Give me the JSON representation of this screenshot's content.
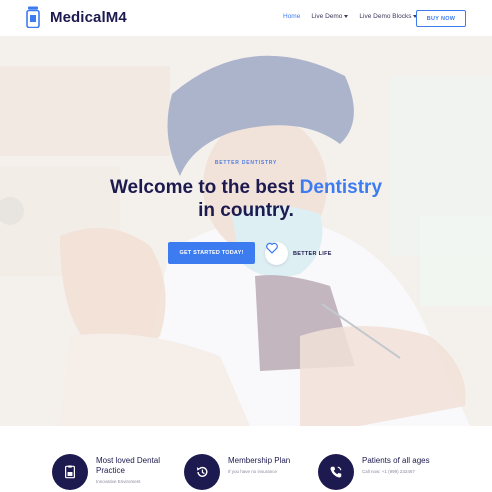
{
  "brand": {
    "name": "MedicalM4",
    "logo_icon": "medicine-bottle-icon",
    "accent": "#3d7bf0",
    "navy": "#1d1a4f"
  },
  "nav": {
    "items": [
      {
        "label": "Home",
        "active": true
      },
      {
        "label": "Live Demo",
        "dropdown": true
      },
      {
        "label": "Live Demo Blocks",
        "dropdown": true
      }
    ],
    "buy_label": "BUY NOW"
  },
  "hero": {
    "eyebrow": "BETTER DENTISTRY",
    "headline_part1": "Welcome to the best ",
    "headline_accent": "Dentistry",
    "headline_part2": "in country.",
    "cta_label": "GET STARTED TODAY!",
    "secondary_label": "BETTER LIFE",
    "secondary_icon": "heart-icon"
  },
  "features": [
    {
      "icon": "id-card-icon",
      "title": "Most loved Dental Practice",
      "subtitle": "Innovative Enviroment"
    },
    {
      "icon": "history-icon",
      "title": "Membership Plan",
      "subtitle": "If you have no insurance"
    },
    {
      "icon": "phone-icon",
      "title": "Patients of all ages",
      "subtitle": "Call now: +1 (999) 232467"
    }
  ]
}
